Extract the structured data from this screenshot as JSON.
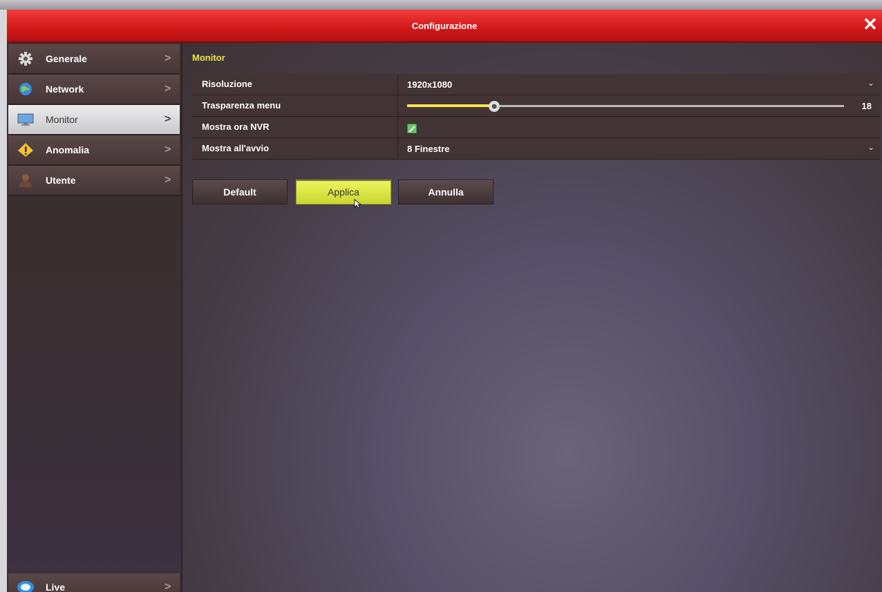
{
  "window": {
    "title": "Configurazione",
    "close_glyph": "✕",
    "title_bar_color": "#d01818"
  },
  "sidebar": {
    "items": [
      {
        "label": "Generale",
        "icon": "gear-icon",
        "arrow": ">"
      },
      {
        "label": "Network",
        "icon": "globe-icon",
        "arrow": ">"
      },
      {
        "label": "Monitor",
        "icon": "monitor-icon",
        "arrow": ">",
        "active": true
      },
      {
        "label": "Anomalia",
        "icon": "warning-icon",
        "arrow": ">"
      },
      {
        "label": "Utente",
        "icon": "user-icon",
        "arrow": ">"
      }
    ],
    "live": {
      "label": "Live",
      "icon": "live-icon",
      "arrow": ">"
    }
  },
  "main": {
    "section_title": "Monitor",
    "rows": {
      "risoluzione": {
        "label": "Risoluzione",
        "value": "1920x1080",
        "chevron": "⌄"
      },
      "trasparenza": {
        "label": "Trasparenza menu",
        "value": "18",
        "level": 0.2
      },
      "mostra_ora": {
        "label": "Mostra ora NVR",
        "checked": true
      },
      "mostra_avvio": {
        "label": "Mostra all'avvio",
        "value": "8 Finestre",
        "chevron": "⌄"
      }
    },
    "buttons": {
      "default": "Default",
      "applica": "Applica",
      "annulla": "Annulla"
    }
  },
  "colors": {
    "accent_yellow": "#f2e64a",
    "active_button": "#d9e43f"
  }
}
